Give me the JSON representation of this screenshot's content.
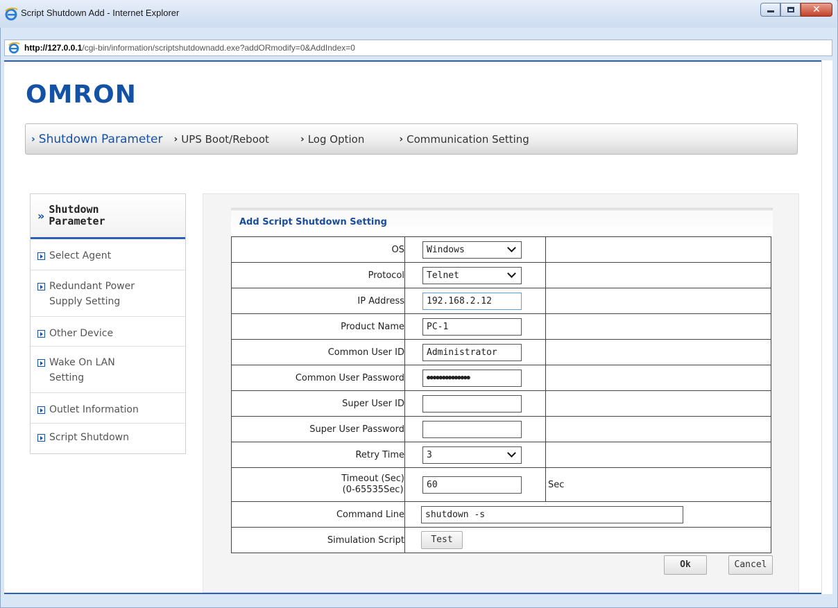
{
  "window": {
    "title": "Script Shutdown Add - Internet Explorer",
    "url_host": "http://127.0.0.1",
    "url_path": "/cgi-bin/information/scriptshutdownadd.exe?addORmodify=0&AddIndex=0"
  },
  "logo": "OMRON",
  "topnav": {
    "items": [
      {
        "label": "Shutdown Parameter"
      },
      {
        "label": "UPS Boot/Reboot"
      },
      {
        "label": "Log Option"
      },
      {
        "label": "Communication Setting"
      }
    ]
  },
  "sidebar": {
    "title_line1": "Shutdown",
    "title_line2": "Parameter",
    "items": [
      {
        "label": "Select Agent"
      },
      {
        "label": "Redundant Power Supply Setting"
      },
      {
        "label": "Other Device"
      },
      {
        "label": "Wake On LAN Setting"
      },
      {
        "label": "Outlet Information"
      },
      {
        "label": "Script Shutdown"
      }
    ]
  },
  "form": {
    "title": "Add Script Shutdown Setting",
    "os": {
      "label": "OS",
      "value": "Windows"
    },
    "protocol": {
      "label": "Protocol",
      "value": "Telnet"
    },
    "ip": {
      "label": "IP Address",
      "value": "192.168.2.12"
    },
    "product": {
      "label": "Product Name",
      "value": "PC-1"
    },
    "common_user": {
      "label": "Common User ID",
      "value": "Administrator"
    },
    "common_pass": {
      "label": "Common User Password",
      "value": "●●●●●●●●●●●●●●"
    },
    "super_user": {
      "label": "Super User ID",
      "value": ""
    },
    "super_pass": {
      "label": "Super User Password",
      "value": ""
    },
    "retry": {
      "label": "Retry Time",
      "value": "3"
    },
    "timeout": {
      "label_line1": "Timeout (Sec)",
      "label_line2": "(0-65535Sec)",
      "value": "60",
      "unit": "Sec"
    },
    "command": {
      "label": "Command Line",
      "value": "shutdown -s"
    },
    "simulation": {
      "label": "Simulation Script",
      "button": "Test"
    }
  },
  "buttons": {
    "ok": "Ok",
    "cancel": "Cancel"
  },
  "colors": {
    "brand_blue": "#1452a6",
    "accent_border": "#2c5fb8"
  }
}
